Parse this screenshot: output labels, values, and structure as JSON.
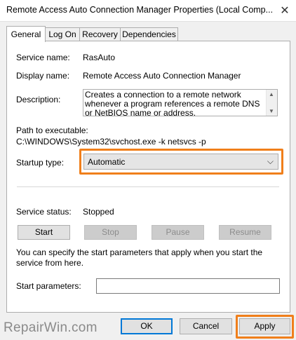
{
  "window": {
    "title": "Remote Access Auto Connection Manager Properties (Local Comp...",
    "close_glyph": "✕"
  },
  "tabs": [
    {
      "label": "General",
      "active": true
    },
    {
      "label": "Log On",
      "active": false
    },
    {
      "label": "Recovery",
      "active": false
    },
    {
      "label": "Dependencies",
      "active": false
    }
  ],
  "general": {
    "service_name_label": "Service name:",
    "service_name_value": "RasAuto",
    "display_name_label": "Display name:",
    "display_name_value": "Remote Access Auto Connection Manager",
    "description_label": "Description:",
    "description_value": "Creates a connection to a remote network whenever a program references a remote DNS or NetBIOS name or address.",
    "path_label": "Path to executable:",
    "path_value": "C:\\WINDOWS\\System32\\svchost.exe -k netsvcs -p",
    "startup_type_label": "Startup type:",
    "startup_type_value": "Automatic",
    "service_status_label": "Service status:",
    "service_status_value": "Stopped",
    "buttons": {
      "start": "Start",
      "stop": "Stop",
      "pause": "Pause",
      "resume": "Resume"
    },
    "info_text": "You can specify the start parameters that apply when you start the service from here.",
    "start_parameters_label": "Start parameters:",
    "start_parameters_value": ""
  },
  "footer": {
    "ok": "OK",
    "cancel": "Cancel",
    "apply": "Apply"
  },
  "watermark": "RepairWin.com",
  "colors": {
    "highlight": "#f07f1b",
    "ok_border": "#0078d7"
  }
}
